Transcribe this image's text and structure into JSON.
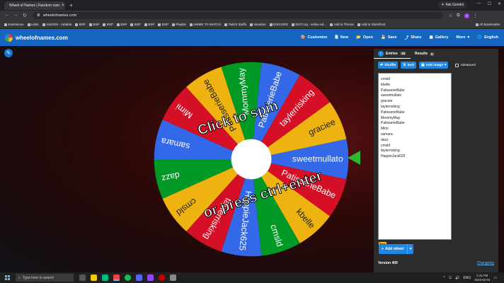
{
  "browser": {
    "tab_title": "Wheel of Names | Random nam",
    "ask_label": "Ask Gemini",
    "url": "wheelofnames.com"
  },
  "bookmarks": [
    "Extensions",
    "Links",
    "AUDIOS - Airtable",
    "BSP",
    "BSP",
    "BSP",
    "BSP",
    "BSP",
    "BSP",
    "BSP",
    "Playlist",
    "ANIME TO WATCH",
    "Twitch Stuffs",
    "Vacation",
    "DISCORD",
    "EDIT.org - online ed...",
    "Add to Throne",
    "Add to Storefront",
    "All Bookmarks"
  ],
  "site": {
    "brand": "wheelofnames.com",
    "menu": [
      "Customize",
      "New",
      "Open",
      "Save",
      "Share",
      "Gallery",
      "More",
      "English"
    ]
  },
  "wheel": {
    "colors": [
      "#3369e8",
      "#d50f25",
      "#eeb211",
      "#009925"
    ],
    "slices": [
      "sweetmullato",
      "PatisserieBabe",
      "kbelle",
      "cmsld",
      "HappieJack625",
      "taylerrisking",
      "cmsld",
      "dazz",
      "samara",
      "Mimi",
      "PatisserieBabe",
      "MommyMay",
      "PatisserieBabe",
      "taylerrisking",
      "graciee"
    ],
    "overlay_top": "Click to spin",
    "overlay_bottom": "or press ctrl+enter"
  },
  "panel": {
    "tab_entries": "Entries",
    "entries_count": "15",
    "tab_results": "Results",
    "results_count": "0",
    "shuffle": "Shuffle",
    "sort": "Sort",
    "add_image": "Add image",
    "advanced": "Advanced",
    "entries": [
      "cmsld",
      "kbelle",
      "PatisserieBabe",
      "sweetmullato",
      "graciee",
      "taylerrisking",
      "PatisserieBabe",
      "MommyMay",
      "PatisserieBabe",
      "Mimi",
      "samara",
      "dazz",
      "cmsld",
      "taylerrisking",
      "HappieJack625"
    ],
    "beta": "Beta",
    "add_wheel": "Add wheel",
    "version": "Version 409",
    "changelog": "Changelog"
  },
  "taskbar": {
    "search_placeholder": "Type here to search",
    "lang": "ENG",
    "time": "2:15 PM",
    "date": "2025-03-04"
  }
}
